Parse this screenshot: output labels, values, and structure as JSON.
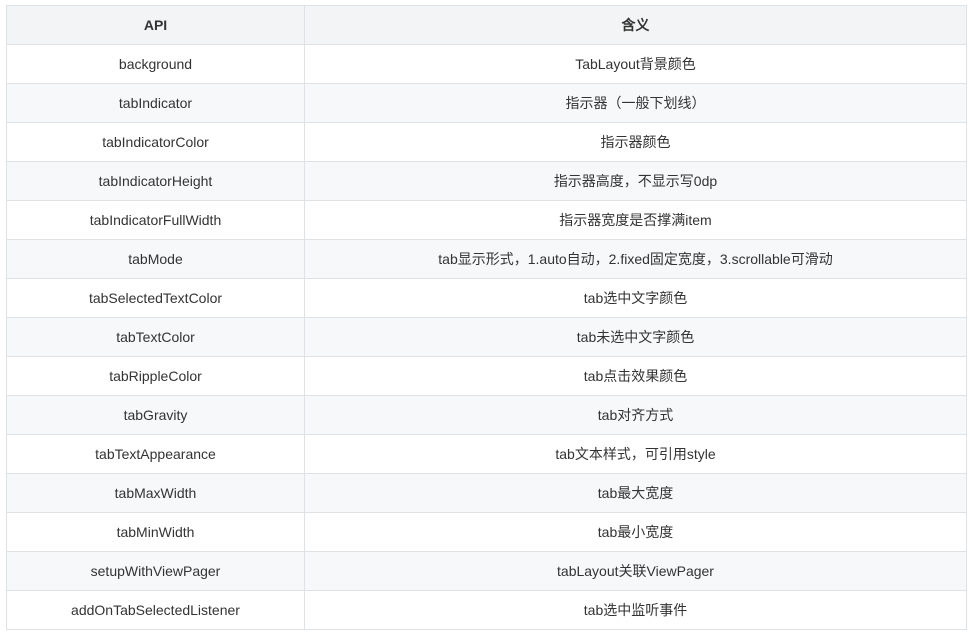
{
  "table": {
    "headers": {
      "api": "API",
      "desc": "含义"
    },
    "rows": [
      {
        "api": "background",
        "desc": "TabLayout背景颜色"
      },
      {
        "api": "tabIndicator",
        "desc": "指示器（一般下划线）"
      },
      {
        "api": "tabIndicatorColor",
        "desc": "指示器颜色"
      },
      {
        "api": "tabIndicatorHeight",
        "desc": "指示器高度，不显示写0dp"
      },
      {
        "api": "tabIndicatorFullWidth",
        "desc": "指示器宽度是否撑满item"
      },
      {
        "api": "tabMode",
        "desc": "tab显示形式，1.auto自动，2.fixed固定宽度，3.scrollable可滑动"
      },
      {
        "api": "tabSelectedTextColor",
        "desc": "tab选中文字颜色"
      },
      {
        "api": "tabTextColor",
        "desc": "tab未选中文字颜色"
      },
      {
        "api": "tabRippleColor",
        "desc": "tab点击效果颜色"
      },
      {
        "api": "tabGravity",
        "desc": "tab对齐方式"
      },
      {
        "api": "tabTextAppearance",
        "desc": "tab文本样式，可引用style"
      },
      {
        "api": "tabMaxWidth",
        "desc": "tab最大宽度"
      },
      {
        "api": "tabMinWidth",
        "desc": "tab最小宽度"
      },
      {
        "api": "setupWithViewPager",
        "desc": "tabLayout关联ViewPager"
      },
      {
        "api": "addOnTabSelectedListener",
        "desc": "tab选中监听事件"
      }
    ]
  }
}
